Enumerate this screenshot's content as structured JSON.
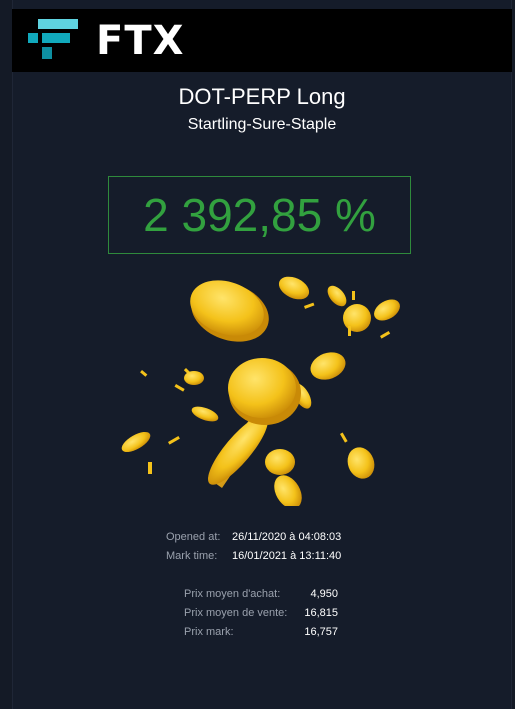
{
  "brand": {
    "name": "FTX",
    "colors": {
      "background": "#151c2a",
      "logo_bar": "#000000",
      "logo_accent": "#11a9bc",
      "positive": "#32a13f",
      "coin_gold": "#f4c21a"
    },
    "icon": "ftx-logo-icon"
  },
  "position": {
    "title": "DOT-PERP Long",
    "account_name": "Startling-Sure-Staple",
    "pnl_percent": "2 392,85 %"
  },
  "illustration": {
    "icon": "gold-coins-icon"
  },
  "dates": [
    {
      "label": "Opened at:",
      "value": "26/11/2020 à 04:08:03"
    },
    {
      "label": "Mark time:",
      "value": "16/01/2021 à 13:11:40"
    }
  ],
  "prices": [
    {
      "label": "Prix moyen d'achat:",
      "value": "4,950"
    },
    {
      "label": "Prix moyen de vente:",
      "value": "16,815"
    },
    {
      "label": "Prix mark:",
      "value": "16,757"
    }
  ]
}
